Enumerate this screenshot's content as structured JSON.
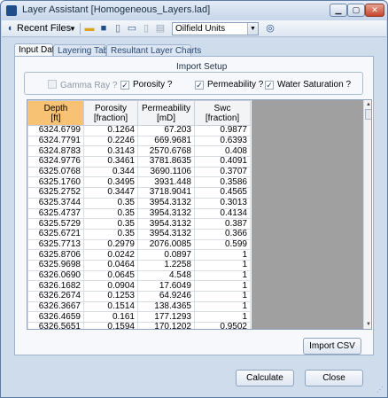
{
  "window": {
    "title": "Layer Assistant [Homogeneous_Layers.lad]",
    "controls": {
      "minimize": "▁",
      "maximize": "▢",
      "close": "✕"
    }
  },
  "toolbar": {
    "recent_files_label": "Recent Files",
    "units_value": "Oilfield Units"
  },
  "tabs": [
    {
      "label": "Input Data"
    },
    {
      "label": "Layering Tables"
    },
    {
      "label": "Resultant Layer Charts"
    }
  ],
  "import_setup": {
    "label": "Import Setup",
    "options": [
      {
        "label": "Gamma Ray ?",
        "checked": false,
        "enabled": false
      },
      {
        "label": "Porosity ?",
        "checked": true,
        "enabled": true
      },
      {
        "label": "Permeability ?",
        "checked": true,
        "enabled": true
      },
      {
        "label": "Water Saturation ?",
        "checked": true,
        "enabled": true
      }
    ]
  },
  "grid": {
    "headers": [
      {
        "name": "Depth",
        "unit": "[ft]"
      },
      {
        "name": "Porosity",
        "unit": "[fraction]"
      },
      {
        "name": "Permeability",
        "unit": "[mD]"
      },
      {
        "name": "Swc",
        "unit": "[fraction]"
      }
    ],
    "rows": [
      [
        "6324.6799",
        "0.1264",
        "67.203",
        "0.9877"
      ],
      [
        "6324.7791",
        "0.2246",
        "669.9681",
        "0.6393"
      ],
      [
        "6324.8783",
        "0.3143",
        "2570.6768",
        "0.408"
      ],
      [
        "6324.9776",
        "0.3461",
        "3781.8635",
        "0.4091"
      ],
      [
        "6325.0768",
        "0.344",
        "3690.1106",
        "0.3707"
      ],
      [
        "6325.1760",
        "0.3495",
        "3931.448",
        "0.3586"
      ],
      [
        "6325.2752",
        "0.3447",
        "3718.9041",
        "0.4565"
      ],
      [
        "6325.3744",
        "0.35",
        "3954.3132",
        "0.3013"
      ],
      [
        "6325.4737",
        "0.35",
        "3954.3132",
        "0.4134"
      ],
      [
        "6325.5729",
        "0.35",
        "3954.3132",
        "0.387"
      ],
      [
        "6325.6721",
        "0.35",
        "3954.3132",
        "0.366"
      ],
      [
        "6325.7713",
        "0.2979",
        "2076.0085",
        "0.599"
      ],
      [
        "6325.8706",
        "0.0242",
        "0.0897",
        "1"
      ],
      [
        "6325.9698",
        "0.0464",
        "1.2258",
        "1"
      ],
      [
        "6326.0690",
        "0.0645",
        "4.548",
        "1"
      ],
      [
        "6326.1682",
        "0.0904",
        "17.6049",
        "1"
      ],
      [
        "6326.2674",
        "0.1253",
        "64.9246",
        "1"
      ],
      [
        "6326.3667",
        "0.1514",
        "138.4365",
        "1"
      ],
      [
        "6326.4659",
        "0.161",
        "177.1293",
        "1"
      ],
      [
        "6326.5651",
        "0.1594",
        "170.1202",
        "0.9502"
      ]
    ]
  },
  "buttons": {
    "import_csv": "Import CSV",
    "calculate": "Calculate",
    "close": "Close"
  }
}
